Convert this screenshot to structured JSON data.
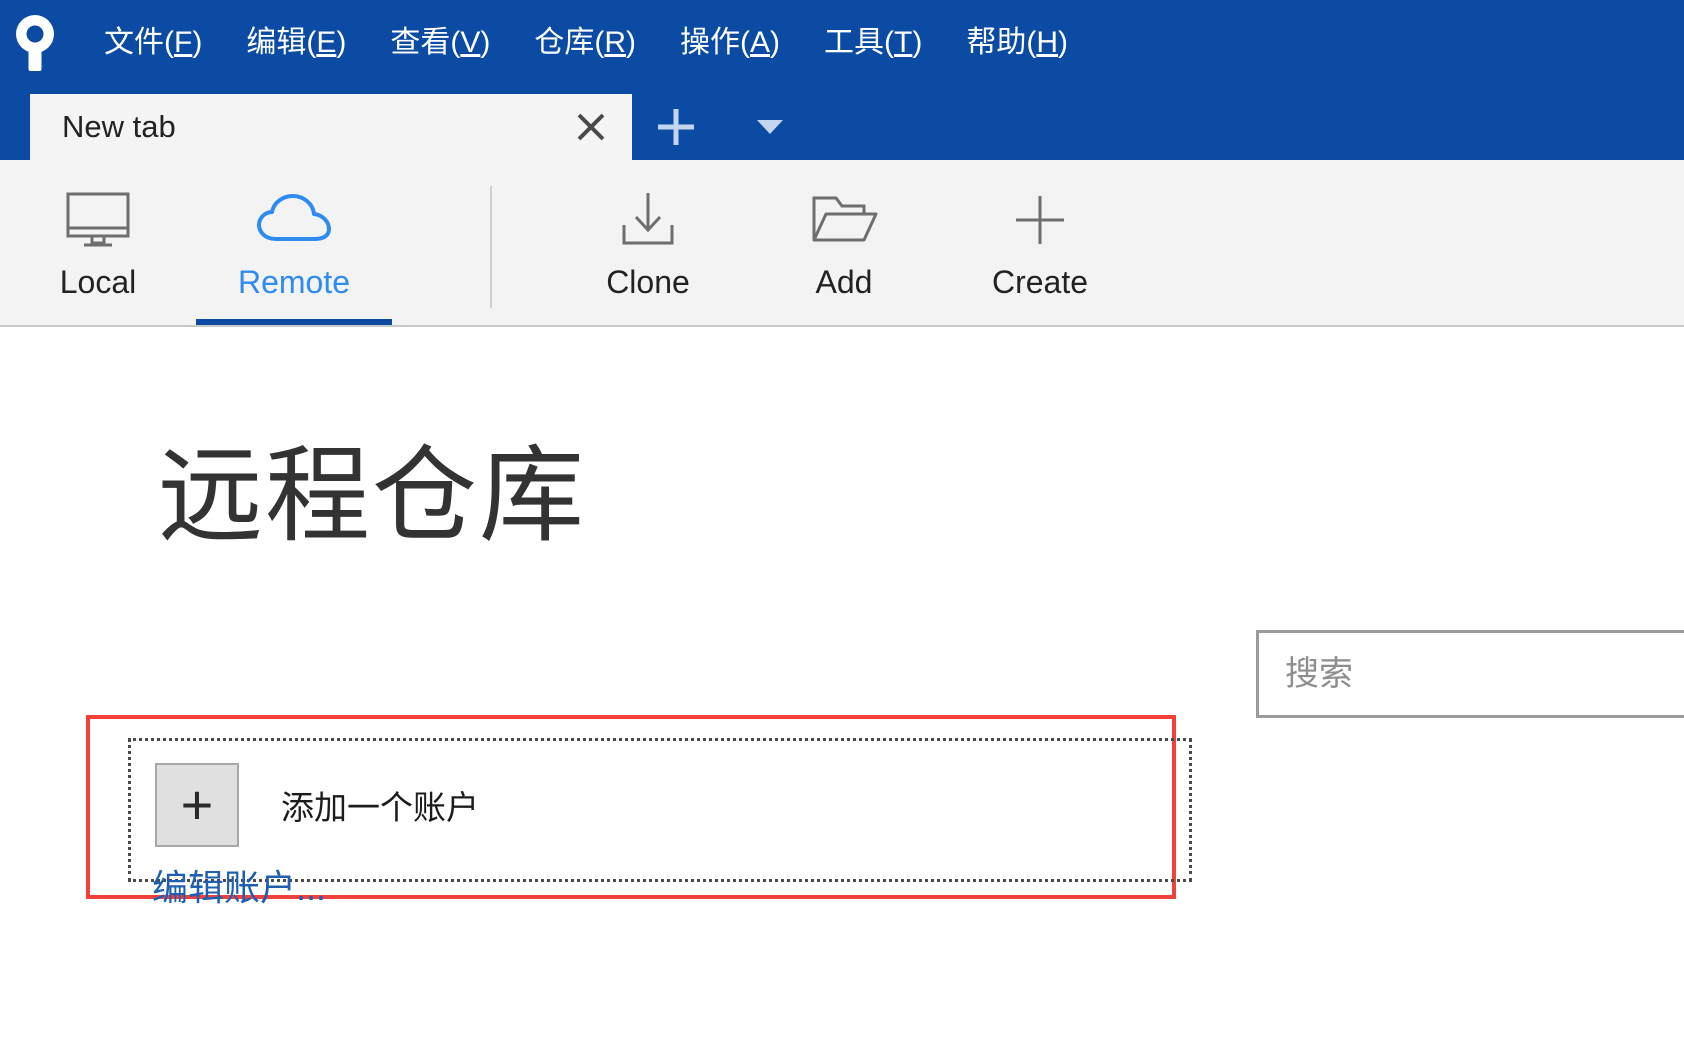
{
  "app": {
    "logo_icon": "sourcetree-logo-icon",
    "titlebar_color": "#0b4ba3"
  },
  "menubar": {
    "items": [
      {
        "label": "文件",
        "accel": "F",
        "name": "menu-file"
      },
      {
        "label": "编辑",
        "accel": "E",
        "name": "menu-edit"
      },
      {
        "label": "查看",
        "accel": "V",
        "name": "menu-view"
      },
      {
        "label": "仓库",
        "accel": "R",
        "name": "menu-repository"
      },
      {
        "label": "操作",
        "accel": "A",
        "name": "menu-actions"
      },
      {
        "label": "工具",
        "accel": "T",
        "name": "menu-tools"
      },
      {
        "label": "帮助",
        "accel": "H",
        "name": "menu-help"
      }
    ]
  },
  "tabs": {
    "active": {
      "label": "New tab",
      "close_icon": "close-icon"
    },
    "new_tab_icon": "plus-icon",
    "tab_menu_icon": "chevron-down-icon"
  },
  "toolbar": {
    "left_group": [
      {
        "label": "Local",
        "icon": "monitor-icon",
        "active": false
      },
      {
        "label": "Remote",
        "icon": "cloud-icon",
        "active": true
      }
    ],
    "right_group": [
      {
        "label": "Clone",
        "icon": "download-icon",
        "active": false
      },
      {
        "label": "Add",
        "icon": "open-folder-icon",
        "active": false
      },
      {
        "label": "Create",
        "icon": "plus-icon",
        "active": false
      }
    ],
    "active_accent_color": "#2e8bf0",
    "active_underline_color": "#0b4ba3"
  },
  "main": {
    "page_title": "远程仓库",
    "accounts": {
      "add_account_label": "添加一个账户",
      "add_account_icon": "plus-icon",
      "edit_accounts_link": "编辑账户...",
      "highlight_color": "#f4403a"
    }
  },
  "search": {
    "placeholder": "搜索",
    "value": "",
    "name": "search-input"
  }
}
